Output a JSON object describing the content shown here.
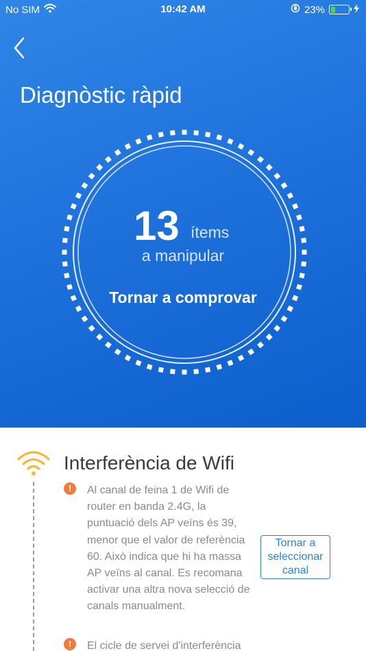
{
  "status_bar": {
    "carrier": "No SIM",
    "time": "10:42 AM",
    "battery_percent": "23%",
    "battery_level": 0.23,
    "icons": [
      "wifi-icon",
      "orientation-lock-icon",
      "battery-icon",
      "charging-bolt-icon"
    ]
  },
  "header": {
    "back_icon": "chevron-left-icon",
    "title": "Diagnòstic ràpid"
  },
  "summary": {
    "count": "13",
    "unit": "ítems",
    "subtitle": "a manipular",
    "recheck_label": "Tornar a comprovar"
  },
  "colors": {
    "hero_top": "#2f86e6",
    "hero_bottom": "#0c5fcc",
    "accent_blue": "#2f7fe0",
    "wifi_yellow": "#f7b733",
    "alert_orange": "#f5793b",
    "text_gray": "#8a8a8a"
  },
  "section": {
    "icon": "wifi-icon",
    "title": "Interferència de Wifi",
    "issues": [
      {
        "icon": "alert-icon",
        "text": "Al canal de feina 1 de Wifi de router en banda 2.4G, la puntuació dels AP veïns és 39, menor que el valor de referència 60. Això indica que hi ha massa AP veïns al canal. Es recomana activar una altra nova selecció de canals manualment.",
        "action_label": "Tornar a seleccionar canal"
      },
      {
        "icon": "alert-icon",
        "text": "El cicle de servei d'interferència"
      }
    ]
  }
}
